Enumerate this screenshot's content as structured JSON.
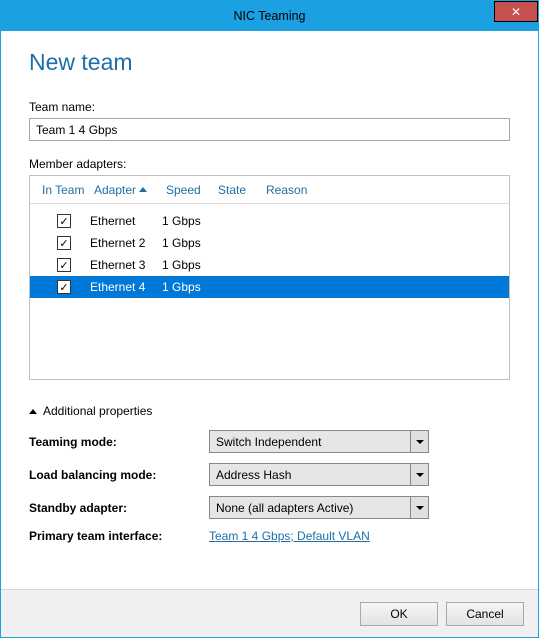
{
  "window": {
    "title": "NIC Teaming"
  },
  "page": {
    "title": "New team"
  },
  "team_name": {
    "label": "Team name:",
    "value": "Team 1 4 Gbps"
  },
  "members": {
    "label": "Member adapters:",
    "columns": {
      "team": "In Team",
      "adapter": "Adapter",
      "speed": "Speed",
      "state": "State",
      "reason": "Reason"
    },
    "rows": [
      {
        "checked": true,
        "adapter": "Ethernet",
        "speed": "1 Gbps",
        "state": "",
        "reason": "",
        "selected": false
      },
      {
        "checked": true,
        "adapter": "Ethernet 2",
        "speed": "1 Gbps",
        "state": "",
        "reason": "",
        "selected": false
      },
      {
        "checked": true,
        "adapter": "Ethernet 3",
        "speed": "1 Gbps",
        "state": "",
        "reason": "",
        "selected": false
      },
      {
        "checked": true,
        "adapter": "Ethernet 4",
        "speed": "1 Gbps",
        "state": "",
        "reason": "",
        "selected": true
      }
    ]
  },
  "props": {
    "header": "Additional properties",
    "teaming_mode": {
      "label": "Teaming mode:",
      "value": "Switch Independent"
    },
    "load_balancing": {
      "label": "Load balancing mode:",
      "value": "Address Hash"
    },
    "standby": {
      "label": "Standby adapter:",
      "value": "None (all adapters Active)"
    },
    "primary_iface": {
      "label": "Primary team interface:",
      "value": "Team 1 4 Gbps; Default VLAN"
    }
  },
  "footer": {
    "ok": "OK",
    "cancel": "Cancel"
  }
}
